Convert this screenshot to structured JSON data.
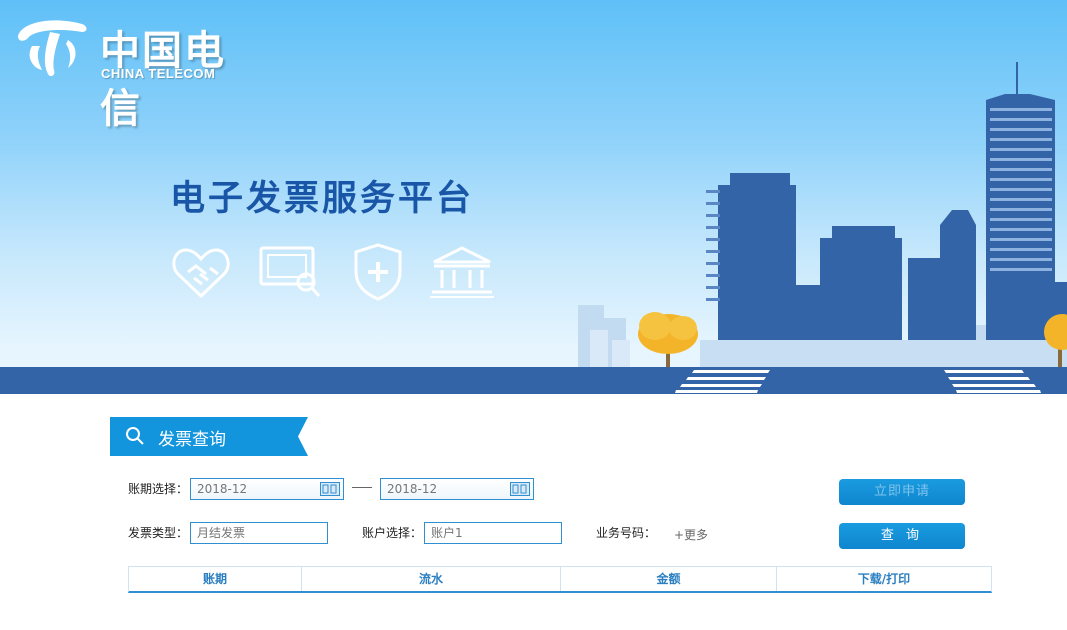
{
  "header": {
    "brand_cn": "中国电信",
    "brand_en": "CHINA TELECOM",
    "platform_title": "电子发票服务平台"
  },
  "section": {
    "title": "发票查询"
  },
  "form": {
    "period_label": "账期选择：",
    "period_start": "2018-12",
    "period_end": "2018-12",
    "invoice_type_label": "发票类型：",
    "invoice_type_placeholder": "月结发票",
    "account_label": "账户选择：",
    "account_placeholder": "账户1",
    "business_number_label": "业务号码：",
    "more_link": "+更多",
    "apply_button": "立即申请",
    "query_button": "查 询"
  },
  "table": {
    "columns": [
      "账期",
      "流水",
      "金额",
      "下载/打印"
    ]
  },
  "colors": {
    "primary_blue": "#1a9be0",
    "title_blue": "#1a56a7",
    "building_blue": "#3464a8"
  },
  "icons": [
    "handshake-icon",
    "screen-search-icon",
    "shield-plus-icon",
    "bank-icon",
    "search-icon",
    "calendar-icon"
  ]
}
